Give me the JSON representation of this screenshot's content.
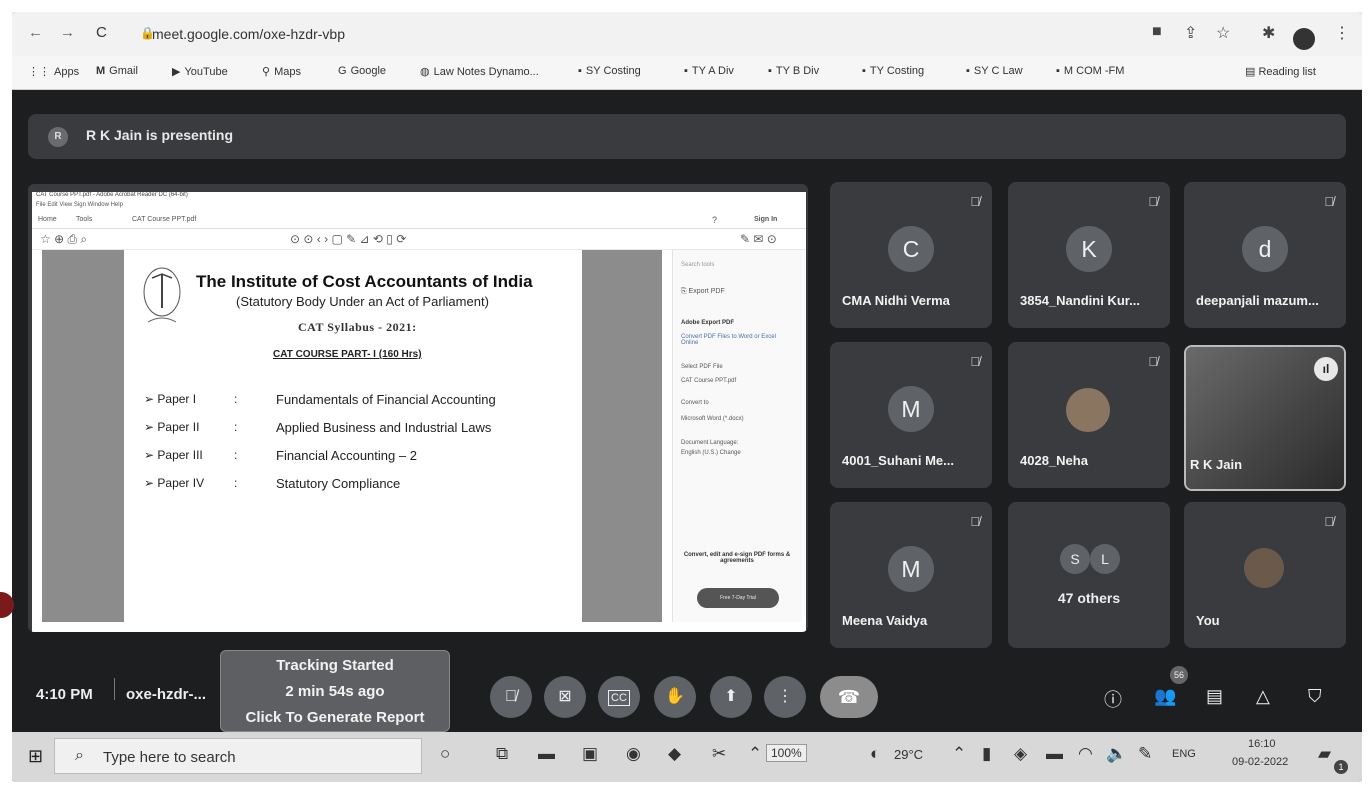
{
  "browser": {
    "url": "meet.google.com/oxe-hzdr-vbp",
    "bookmarks": [
      {
        "icon": "apps-icon",
        "label": "Apps"
      },
      {
        "icon": "gmail-icon",
        "label": "Gmail"
      },
      {
        "icon": "youtube-icon",
        "label": "YouTube"
      },
      {
        "icon": "maps-icon",
        "label": "Maps"
      },
      {
        "icon": "google-icon",
        "label": "Google"
      },
      {
        "icon": "globe-icon",
        "label": "Law Notes Dynamo..."
      },
      {
        "icon": "folder-icon",
        "label": "SY Costing"
      },
      {
        "icon": "folder-icon",
        "label": "TY A Div"
      },
      {
        "icon": "folder-icon",
        "label": "TY B Div"
      },
      {
        "icon": "folder-icon",
        "label": "TY Costing"
      },
      {
        "icon": "folder-icon",
        "label": "SY C Law"
      },
      {
        "icon": "folder-icon",
        "label": "M COM -FM"
      }
    ],
    "reading_list": "Reading list"
  },
  "meet": {
    "presenter_initial": "R",
    "presenting_text": "R K Jain is presenting",
    "time": "4:10 PM",
    "meeting_code": "oxe-hzdr-...",
    "tracking": {
      "line1": "Tracking Started",
      "line2": "2 min 54s ago",
      "line3": "Click To Generate Report"
    },
    "participants_count": "56",
    "tiles": [
      {
        "initial": "C",
        "name": "CMA Nidhi Verma"
      },
      {
        "initial": "K",
        "name": "3854_Nandini Kur..."
      },
      {
        "initial": "d",
        "name": "deepanjali mazum..."
      },
      {
        "initial": "M",
        "name": "4001_Suhani Me..."
      },
      {
        "initial": "",
        "name": "4028_Neha"
      },
      {
        "initial": "",
        "name": "R K Jain"
      },
      {
        "initial": "M",
        "name": "Meena Vaidya"
      },
      {
        "initial": "",
        "name": "47 others",
        "avatars": [
          "S",
          "L"
        ]
      },
      {
        "initial": "",
        "name": "You"
      }
    ]
  },
  "document": {
    "window_title": "CAT Course PPT.pdf - Adobe Acrobat Reader DC (64-bit)",
    "menu": "File  Edit  View  Sign  Window  Help",
    "tabs": [
      "Home",
      "Tools",
      "CAT Course PPT.pdf"
    ],
    "sign_in": "Sign In",
    "institute": "The Institute of Cost Accountants of India",
    "subtitle": "(Statutory Body Under an Act of Parliament)",
    "syllabus": "CAT Syllabus - 2021:",
    "course": "CAT COURSE PART- I (160 Hrs)",
    "papers": [
      {
        "name": "Paper I",
        "title": "Fundamentals of Financial Accounting"
      },
      {
        "name": "Paper II",
        "title": "Applied Business and Industrial Laws"
      },
      {
        "name": "Paper III",
        "title": "Financial Accounting – 2"
      },
      {
        "name": "Paper IV",
        "title": "Statutory Compliance"
      }
    ],
    "panel": {
      "search": "Search tools",
      "export": "Export PDF",
      "heading": "Adobe Export PDF",
      "desc": "Convert PDF Files to Word or Excel Online",
      "select_label": "Select PDF File",
      "file": "CAT Course PPT.pdf",
      "convert_label": "Convert to",
      "convert_value": "Microsoft Word (*.docx)",
      "lang_label": "Document Language:",
      "lang_value": "English (U.S.) Change",
      "promo": "Convert, edit and e-sign PDF forms & agreements",
      "trial": "Free 7-Day Trial"
    }
  },
  "taskbar": {
    "search_placeholder": "Type here to search",
    "zoom": "100%",
    "temperature": "29°C",
    "lang": "ENG",
    "clock_time": "16:10",
    "clock_date": "09-02-2022",
    "notif": "1"
  }
}
